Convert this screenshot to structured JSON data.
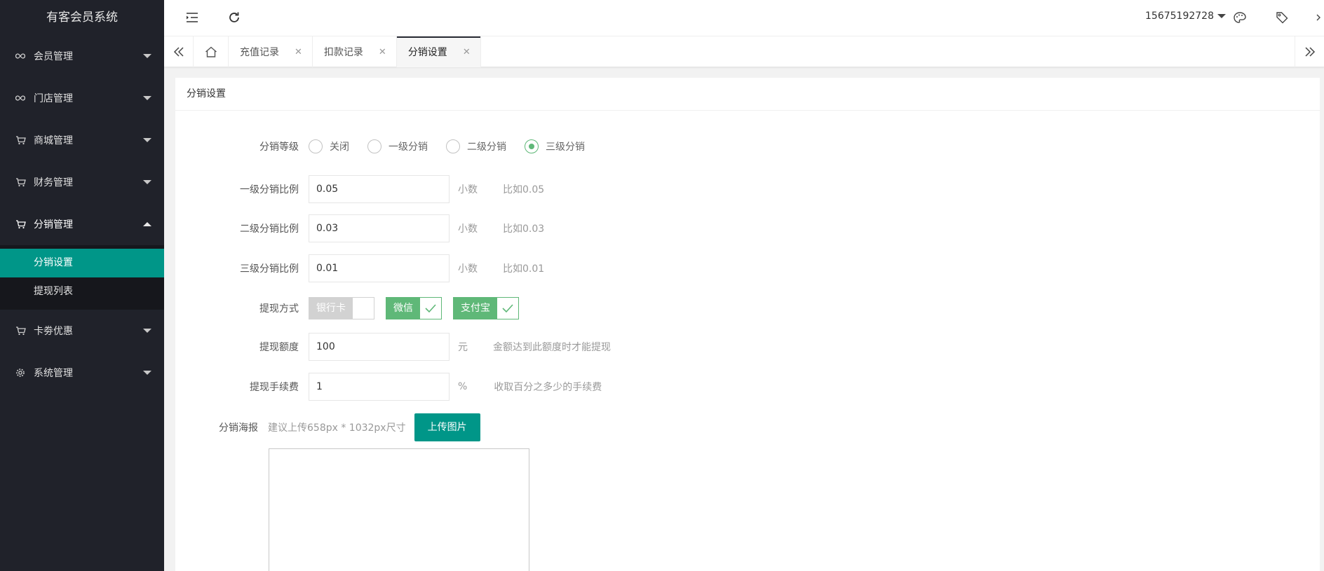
{
  "app": {
    "title": "有客会员系统"
  },
  "sidebar": {
    "items": [
      {
        "label": "会员管理",
        "icon": "infinity-icon"
      },
      {
        "label": "门店管理",
        "icon": "infinity-icon"
      },
      {
        "label": "商城管理",
        "icon": "cart-icon"
      },
      {
        "label": "财务管理",
        "icon": "cart-icon"
      },
      {
        "label": "分销管理",
        "icon": "cart-icon",
        "expanded": true,
        "children": [
          {
            "label": "分销设置",
            "active": true
          },
          {
            "label": "提现列表"
          }
        ]
      },
      {
        "label": "卡劵优惠",
        "icon": "cart-icon"
      },
      {
        "label": "系统管理",
        "icon": "gear-icon"
      }
    ]
  },
  "header": {
    "user": "15675192728"
  },
  "tabs": [
    {
      "label": "充值记录"
    },
    {
      "label": "扣款记录"
    },
    {
      "label": "分销设置",
      "active": true
    }
  ],
  "card": {
    "title": "分销设置"
  },
  "form": {
    "level": {
      "label": "分销等级",
      "options": [
        "关闭",
        "一级分销",
        "二级分销",
        "三级分销"
      ],
      "selected": "三级分销"
    },
    "ratio1": {
      "label": "一级分销比例",
      "value": "0.05",
      "unit": "小数",
      "hint": "比如0.05"
    },
    "ratio2": {
      "label": "二级分销比例",
      "value": "0.03",
      "unit": "小数",
      "hint": "比如0.03"
    },
    "ratio3": {
      "label": "三级分销比例",
      "value": "0.01",
      "unit": "小数",
      "hint": "比如0.01"
    },
    "method": {
      "label": "提现方式",
      "options": [
        {
          "label": "银行卡",
          "checked": false
        },
        {
          "label": "微信",
          "checked": true
        },
        {
          "label": "支付宝",
          "checked": true
        }
      ]
    },
    "amount": {
      "label": "提现额度",
      "value": "100",
      "unit": "元",
      "hint": "金额达到此额度时才能提现"
    },
    "fee": {
      "label": "提现手续费",
      "value": "1",
      "unit": "%",
      "hint": "收取百分之多少的手续费"
    },
    "poster": {
      "label": "分销海报",
      "hint": "建议上传658px * 1032px尺寸",
      "button": "上传图片"
    }
  },
  "colors": {
    "sidebar": "#20222a",
    "accent": "#009688",
    "check": "#5fb878"
  }
}
